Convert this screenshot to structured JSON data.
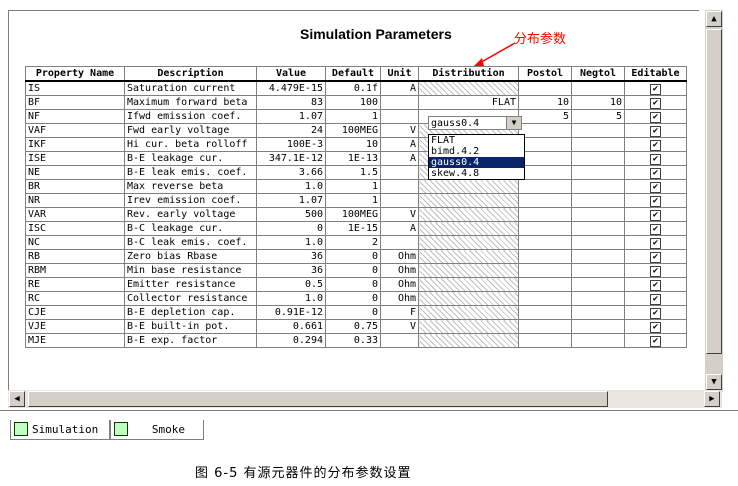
{
  "title": "Simulation Parameters",
  "annotation": "分布参数",
  "caption": "图 6-5 有源元器件的分布参数设置",
  "columns": [
    "Property Name",
    "Description",
    "Value",
    "Default",
    "Unit",
    "Distribution",
    "Postol",
    "Negtol",
    "Editable"
  ],
  "rows": [
    [
      "IS",
      "Saturation current",
      "4.479E-15",
      "0.1f",
      "A",
      "",
      "",
      "",
      "✔"
    ],
    [
      "BF",
      "Maximum forward beta",
      "83",
      "100",
      "",
      "FLAT",
      "10",
      "10",
      "✔"
    ],
    [
      "NF",
      "Ifwd emission coef.",
      "1.07",
      "1",
      "",
      "",
      "5",
      "5",
      "✔"
    ],
    [
      "VAF",
      "Fwd early voltage",
      "24",
      "100MEG",
      "V",
      "",
      "",
      "",
      "✔"
    ],
    [
      "IKF",
      "Hi cur. beta rolloff",
      "100E-3",
      "10",
      "A",
      "",
      "",
      "",
      "✔"
    ],
    [
      "ISE",
      "B-E leakage cur.",
      "347.1E-12",
      "1E-13",
      "A",
      "",
      "",
      "",
      "✔"
    ],
    [
      "NE",
      "B-E leak emis. coef.",
      "3.66",
      "1.5",
      "",
      "",
      "",
      "",
      "✔"
    ],
    [
      "BR",
      "Max reverse beta",
      "1.0",
      "1",
      "",
      "",
      "",
      "",
      "✔"
    ],
    [
      "NR",
      "Irev emission coef.",
      "1.07",
      "1",
      "",
      "",
      "",
      "",
      "✔"
    ],
    [
      "VAR",
      "Rev. early voltage",
      "500",
      "100MEG",
      "V",
      "",
      "",
      "",
      "✔"
    ],
    [
      "ISC",
      "B-C leakage cur.",
      "0",
      "1E-15",
      "A",
      "",
      "",
      "",
      "✔"
    ],
    [
      "NC",
      "B-C leak emis. coef.",
      "1.0",
      "2",
      "",
      "",
      "",
      "",
      "✔"
    ],
    [
      "RB",
      "Zero bias Rbase",
      "36",
      "0",
      "Ohm",
      "",
      "",
      "",
      "✔"
    ],
    [
      "RBM",
      "Min base resistance",
      "36",
      "0",
      "Ohm",
      "",
      "",
      "",
      "✔"
    ],
    [
      "RE",
      "Emitter resistance",
      "0.5",
      "0",
      "Ohm",
      "",
      "",
      "",
      "✔"
    ],
    [
      "RC",
      "Collector resistance",
      "1.0",
      "0",
      "Ohm",
      "",
      "",
      "",
      "✔"
    ],
    [
      "CJE",
      "B-E depletion cap.",
      "0.91E-12",
      "0",
      "F",
      "",
      "",
      "",
      "✔"
    ],
    [
      "VJE",
      "B-E built-in pot.",
      "0.661",
      "0.75",
      "V",
      "",
      "",
      "",
      "✔"
    ],
    [
      "MJE",
      "B-E exp. factor",
      "0.294",
      "0.33",
      "",
      "",
      "",
      "",
      "✔"
    ]
  ],
  "combo": {
    "value": "gauss0.4"
  },
  "dropdown_options": [
    "FLAT",
    "bimd.4.2",
    "gauss0.4",
    "skew.4.8"
  ],
  "dropdown_selected": 2,
  "tabs": [
    "Simulation",
    "Smoke"
  ]
}
